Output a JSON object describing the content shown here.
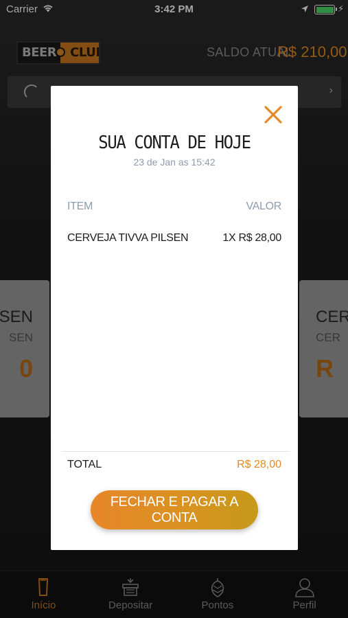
{
  "status_bar": {
    "carrier": "Carrier",
    "time": "3:42 PM",
    "battery_color": "#4cd964"
  },
  "header": {
    "logo_left": "BEER",
    "logo_right": "CLUB",
    "saldo_label": "SALDO ATUAL",
    "saldo_value": "R$ 210,00"
  },
  "background_cards": {
    "left": {
      "title": "ILSEN",
      "subtitle": "SEN",
      "value": "0"
    },
    "right": {
      "title": "CERVE",
      "subtitle": "CER",
      "value": "R"
    }
  },
  "modal": {
    "title": "SUA CONTA DE HOJE",
    "date": "23 de Jan as 15:42",
    "columns": {
      "item": "ITEM",
      "valor": "VALOR"
    },
    "items": [
      {
        "name": "CERVEJA TIVVA PILSEN",
        "value": "1X R$ 28,00"
      }
    ],
    "total_label": "TOTAL",
    "total_value": "R$ 28,00",
    "pay_button": "FECHAR E PAGAR A CONTA",
    "close_icon": "close-icon"
  },
  "tab_bar": {
    "tabs": [
      {
        "label": "Início",
        "icon": "beer-glass-icon",
        "active": true
      },
      {
        "label": "Depositar",
        "icon": "deposit-icon",
        "active": false
      },
      {
        "label": "Pontos",
        "icon": "hop-icon",
        "active": false
      },
      {
        "label": "Perfil",
        "icon": "user-icon",
        "active": false
      }
    ]
  },
  "colors": {
    "accent": "#e38a26",
    "muted_label": "#8d9cae",
    "tab_inactive": "#8a8a8a"
  }
}
